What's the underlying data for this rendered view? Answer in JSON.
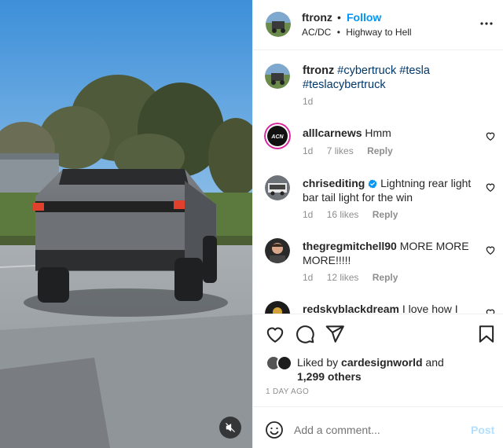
{
  "post": {
    "username": "ftronz",
    "separator": "•",
    "follow_label": "Follow",
    "audio_artist": "AC/DC",
    "audio_separator": "•",
    "audio_track": "Highway to Hell"
  },
  "caption": {
    "username": "ftronz",
    "text": "#cybertruck #tesla #teslacybertruck",
    "age": "1d"
  },
  "comments": [
    {
      "username": "alllcarnews",
      "text": "Hmm",
      "age": "1d",
      "likes": "7 likes",
      "reply_label": "Reply"
    },
    {
      "username": "chrisediting",
      "verified": true,
      "text": "Lightning rear light bar tail light for the win",
      "age": "1d",
      "likes": "16 likes",
      "reply_label": "Reply"
    },
    {
      "username": "thegregmitchell90",
      "text": "MORE MORE MORE!!!!!",
      "age": "1d",
      "likes": "12 likes",
      "reply_label": "Reply"
    },
    {
      "username": "redskyblackdream",
      "text": "I love how I"
    }
  ],
  "likes": {
    "prefix": "Liked by",
    "user": "cardesignworld",
    "joiner": "and",
    "others": "1,299 others"
  },
  "date": "1 DAY AGO",
  "add_comment": {
    "placeholder": "Add a comment...",
    "post_label": "Post"
  },
  "colors": {
    "accent": "#0095f6",
    "post_disabled": "#b2dffc",
    "verified": "#0095f6",
    "muted_text": "#8e8e8e"
  },
  "icons": {
    "more": "more-horizontal-icon",
    "like": "heart-icon",
    "comment": "comment-icon",
    "share": "send-icon",
    "save": "bookmark-icon",
    "emoji": "emoji-icon",
    "mute": "muted-speaker-icon"
  }
}
